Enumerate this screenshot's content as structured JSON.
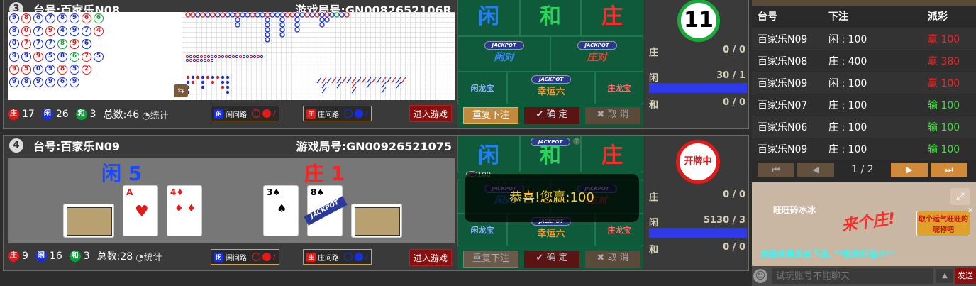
{
  "top_table": {
    "num": "3",
    "name": "台号:百家乐N08",
    "game_id": "游戏局号:GN0082652106R",
    "stats": {
      "banker_label": "庄",
      "banker": "17",
      "player_label": "闲",
      "player": "26",
      "tie_label": "和",
      "tie": "3",
      "total": "总数:46",
      "stat_btn": "统计"
    },
    "ask_player": "闲问路",
    "ask_banker": "庄问路",
    "enter": "进入游戏",
    "bet": {
      "player": "闲",
      "tie": "和",
      "banker": "庄",
      "jackpot": "JACKPOT",
      "player_pair": "闲对",
      "banker_pair": "庄对",
      "lucky6": "幸运六",
      "player_dragon": "闲龙宝",
      "banker_dragon": "庄龙宝",
      "repeat": "重复下注",
      "confirm": "确 定",
      "cancel": "取 消"
    },
    "status": {
      "countdown": "11",
      "banker_label": "庄",
      "banker_val": "0 / 0",
      "player_label": "闲",
      "player_val": "30 / 1",
      "tie_label": "和",
      "tie_val": "0 / 0"
    }
  },
  "bottom_table": {
    "num": "4",
    "name": "台号:百家乐N09",
    "game_id": "游戏局号:GN00926521075",
    "player_result": "闲 5",
    "banker_result": "庄 1",
    "stats": {
      "banker_label": "庄",
      "banker": "9",
      "player_label": "闲",
      "player": "16",
      "tie_label": "和",
      "tie": "3",
      "total": "总数:28",
      "stat_btn": "统计"
    },
    "ask_player": "闲问路",
    "ask_banker": "庄问路",
    "enter": "进入游戏",
    "win_msg": "恭喜!您赢:100",
    "chip": "100",
    "help": "?",
    "bet": {
      "player": "闲",
      "tie": "和",
      "banker": "庄",
      "jackpot": "JACKPOT",
      "player_pair": "闲对",
      "banker_pair": "庄对",
      "lucky6": "幸运六",
      "player_dragon": "闲龙宝",
      "banker_dragon": "庄龙宝",
      "repeat": "重复下注",
      "confirm": "确 定",
      "cancel": "取 消"
    },
    "status": {
      "state": "开牌中",
      "banker_label": "庄",
      "banker_val": "0 / 0",
      "player_label": "闲",
      "player_val": "5130 / 3",
      "tie_label": "和",
      "tie_val": "0 / 0"
    }
  },
  "history": {
    "headers": [
      "台号",
      "下注",
      "派彩"
    ],
    "rows": [
      {
        "table": "百家乐N09",
        "bet": "闲 : 100",
        "result": "赢 100",
        "win": true
      },
      {
        "table": "百家乐N08",
        "bet": "庄 : 400",
        "result": "赢 380",
        "win": true
      },
      {
        "table": "百家乐N09",
        "bet": "闲 : 100",
        "result": "赢 100",
        "win": true
      },
      {
        "table": "百家乐N07",
        "bet": "庄 : 100",
        "result": "输 100",
        "win": false
      },
      {
        "table": "百家乐N06",
        "bet": "庄 : 100",
        "result": "输 100",
        "win": false
      },
      {
        "table": "百家乐N09",
        "bet": "庄 : 100",
        "result": "输 100",
        "win": false
      }
    ],
    "page": "1 / 2"
  },
  "chat": {
    "user": "旺旺碎冰冰",
    "sticker_text": "来个庄!",
    "side_btn": "取个运气旺旺的昵称吧",
    "welcome": "欢迎来到多台下注, **祝你好运!!**",
    "placeholder": "试玩账号不能聊天",
    "send": "发送"
  },
  "colors": {
    "banker": "#e21a1a",
    "player": "#1a2fe2",
    "tie": "#0ba33a",
    "bet_green": "#0e5a3a",
    "win_red": "#ff2020",
    "lose_green": "#3fe03f"
  }
}
